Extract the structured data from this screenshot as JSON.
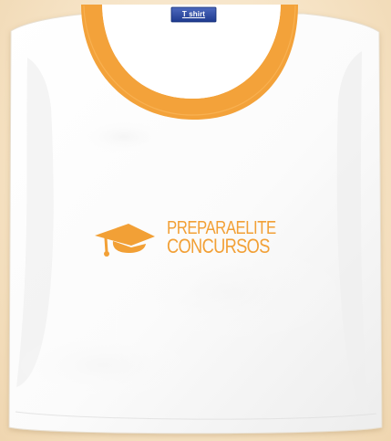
{
  "product": {
    "tag": "T shirt",
    "brand": {
      "line_1": "PREPARAELITE",
      "line_2": "CONCURSOS"
    }
  },
  "icons": {
    "logo": "graduation-cap-icon"
  },
  "colors": {
    "background": "#f6e3c5",
    "shirt": "#ffffff",
    "collar": "#f3a23a",
    "brand": "#f2a036",
    "tag": "#26469b"
  }
}
